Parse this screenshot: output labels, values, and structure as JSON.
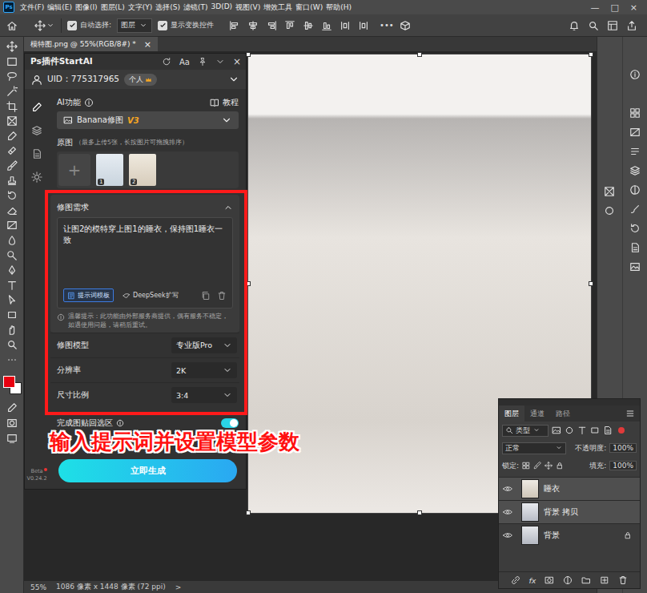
{
  "app": {
    "logo": "Ps",
    "menu": [
      "文件(F)",
      "编辑(E)",
      "图像(I)",
      "图层(L)",
      "文字(Y)",
      "选择(S)",
      "滤镜(T)",
      "3D(D)",
      "视图(V)",
      "增效工具",
      "窗口(W)",
      "帮助(H)"
    ],
    "window_controls": [
      "—",
      "□",
      "×"
    ]
  },
  "options_bar": {
    "auto_select": {
      "label": "自动选择:",
      "checked": true
    },
    "target": "图层",
    "show_transform": {
      "label": "显示变换控件",
      "checked": true
    },
    "more": "•••"
  },
  "document_tab": {
    "title": "模特图.png @ 55%(RGB/8#) *",
    "close": "×",
    "selected": true
  },
  "colors": {
    "foreground": "#e8000f",
    "background": "#ffffff"
  },
  "plugin": {
    "title": "Ps插件StartAI",
    "font_button": "Aa",
    "close": "×",
    "uid": "UID：775317965",
    "account_badge": "个人",
    "nav": [
      {
        "selected": true
      },
      {
        "selected": false
      },
      {
        "selected": false
      },
      {
        "selected": false
      }
    ],
    "ai_function": {
      "label": "AI功能",
      "tutorial": "教程"
    },
    "model": {
      "name": "Banana修图",
      "version": "V3"
    },
    "source": {
      "label": "原图",
      "hint": "（最多上传5张，长按图片可拖拽排序）",
      "add": "+",
      "images": [
        {
          "index": "1"
        },
        {
          "index": "2"
        }
      ]
    },
    "prompt": {
      "title": "修图需求",
      "expanded": true,
      "text": "让图2的模特穿上图1的睡衣，保持图1睡衣一致",
      "actions": [
        {
          "label": "提示词模板",
          "selected": true
        },
        {
          "label": "DeepSeek扩写",
          "selected": false
        }
      ],
      "notice": "温馨提示：此功能由外部服务商提供，偶有服务不稳定，如遇使用问题，请稍后重试。"
    },
    "settings": [
      {
        "label": "修图模型",
        "value": "专业版Pro"
      },
      {
        "label": "分辨率",
        "value": "2K"
      },
      {
        "label": "尺寸比例",
        "value": "3:4"
      }
    ],
    "paste_back": {
      "label": "完成图贴回选区",
      "on": true
    },
    "generate": "立即生成",
    "build": {
      "label": "Beta",
      "version": "V0.24.2"
    }
  },
  "annotation": {
    "text": "输入提示词并设置模型参数"
  },
  "layers_panel": {
    "tabs": [
      {
        "label": "图层",
        "selected": true
      },
      {
        "label": "通道",
        "selected": false
      },
      {
        "label": "路径",
        "selected": false
      }
    ],
    "filter": "类型",
    "blend_mode": "正常",
    "opacity": {
      "label": "不透明度:",
      "value": "100%"
    },
    "lock": {
      "label": "锁定:"
    },
    "fill": {
      "label": "填充:",
      "value": "100%"
    },
    "layers": [
      {
        "name": "睡衣",
        "visible": true,
        "selected": true,
        "locked": false
      },
      {
        "name": "背景 拷贝",
        "visible": true,
        "selected": true,
        "locked": false
      },
      {
        "name": "背景",
        "visible": true,
        "selected": false,
        "locked": true
      }
    ],
    "fx": "fx"
  },
  "status_bar": {
    "zoom": "55%",
    "size": "1086 像素 x 1448 像素 (72 ppi)",
    "arrow": ">"
  }
}
